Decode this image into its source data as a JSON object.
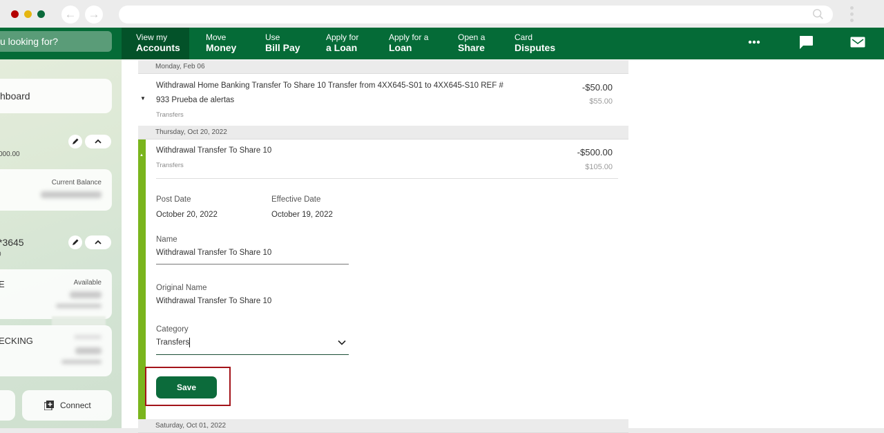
{
  "browser": {
    "back_icon": "arrow-left-icon",
    "forward_icon": "arrow-right-icon",
    "url": "",
    "search_icon": "search-icon",
    "menu_icon": "kebab-menu-icon"
  },
  "nav": {
    "search_placeholder": "u looking for?",
    "items": [
      {
        "line1": "View my",
        "line2": "Accounts",
        "active": true
      },
      {
        "line1": "Move",
        "line2": "Money"
      },
      {
        "line1": "Use",
        "line2": "Bill Pay"
      },
      {
        "line1": "Apply for",
        "line2": "a Loan"
      },
      {
        "line1": "Apply for a",
        "line2": "Loan"
      },
      {
        "line1": "Open a",
        "line2": "Share"
      },
      {
        "line1": "Card",
        "line2": "Disputes"
      }
    ],
    "more_icon": "more-icon",
    "chat_icon": "chat-icon",
    "mail_icon": "mail-icon"
  },
  "sidebar": {
    "dashboard_label": "hboard",
    "group1": {
      "amount": "000.00",
      "card_balance_label": "Current Balance"
    },
    "group2": {
      "account_number": "*3645",
      "sub": "0"
    },
    "accounts": [
      {
        "name": "E",
        "balance_label": "Available"
      },
      {
        "name": "ECKING",
        "balance_label": ""
      }
    ],
    "connect_label": "Connect"
  },
  "transactions": [
    {
      "date": "Monday, Feb 06",
      "title_line1": "Withdrawal Home Banking Transfer To Share 10 Transfer from 4XX645-S01 to 4XX645-S10 REF #",
      "title_line2": "933 Prueba de alertas",
      "category": "Transfers",
      "amount": "-$50.00",
      "balance": "$55.00"
    },
    {
      "date": "Thursday, Oct 20, 2022",
      "title": "Withdrawal Transfer To Share 10",
      "category": "Transfers",
      "amount": "-$500.00",
      "balance": "$105.00",
      "details": {
        "post_date_label": "Post Date",
        "post_date": "October 20, 2022",
        "effective_date_label": "Effective Date",
        "effective_date": "October 19, 2022",
        "name_label": "Name",
        "name_value": "Withdrawal Transfer To Share 10",
        "original_name_label": "Original Name",
        "original_name": "Withdrawal Transfer To Share 10",
        "category_label": "Category",
        "category_value": "Transfers",
        "save_label": "Save"
      }
    },
    {
      "date": "Saturday, Oct 01, 2022"
    }
  ],
  "colors": {
    "brand_green": "#056b37",
    "accent_lime": "#7ab51d",
    "highlight_red": "#a31319"
  }
}
